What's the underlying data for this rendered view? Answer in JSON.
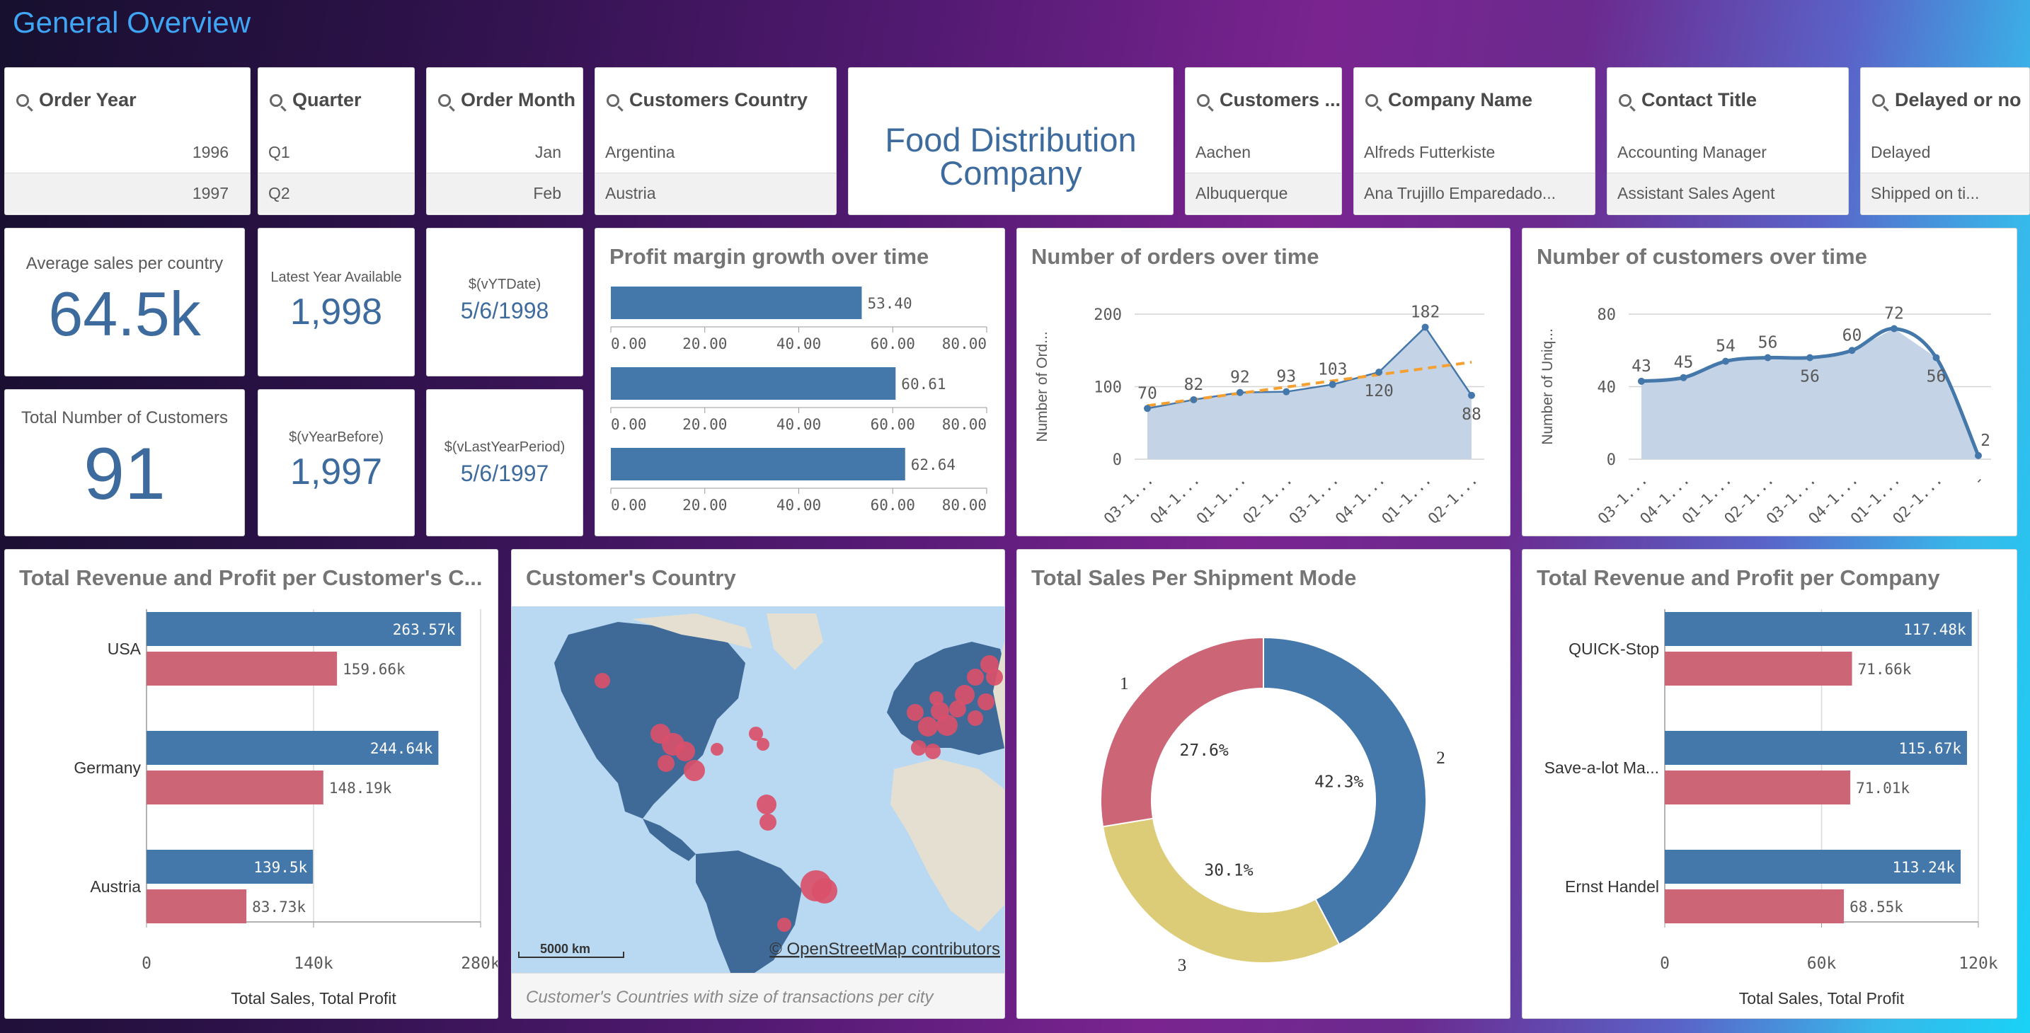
{
  "header": {
    "title": "General Overview"
  },
  "filters": [
    {
      "id": "order-year",
      "title": "Order Year",
      "items": [
        "1996",
        "1997"
      ],
      "numeric": true
    },
    {
      "id": "quarter",
      "title": "Quarter",
      "items": [
        "Q1",
        "Q2"
      ],
      "numeric": false
    },
    {
      "id": "order-month",
      "title": "Order Month",
      "items": [
        "Jan",
        "Feb"
      ],
      "numeric": true
    },
    {
      "id": "customers-country",
      "title": "Customers Country",
      "items": [
        "Argentina",
        "Austria"
      ],
      "numeric": false
    },
    {
      "id": "customers-city",
      "title": "Customers ...",
      "items": [
        "Aachen",
        "Albuquerque"
      ],
      "numeric": false
    },
    {
      "id": "company-name",
      "title": "Company Name",
      "items": [
        "Alfreds Futterkiste",
        "Ana Trujillo Emparedado..."
      ],
      "numeric": false
    },
    {
      "id": "contact-title",
      "title": "Contact Title",
      "items": [
        "Accounting Manager",
        "Assistant Sales Agent"
      ],
      "numeric": false
    },
    {
      "id": "delayed",
      "title": "Delayed or no",
      "items": [
        "Delayed",
        "Shipped on ti..."
      ],
      "numeric": false
    }
  ],
  "company_banner": {
    "line1": "Food Distribution",
    "line2": "Company"
  },
  "kpis": {
    "avg_sales": {
      "label": "Average sales per country",
      "value": "64.5k"
    },
    "total_customers": {
      "label": "Total Number of Customers",
      "value": "91"
    },
    "latest_year": {
      "label": "Latest Year Available",
      "value": "1,998"
    },
    "year_before": {
      "label": "$(vYearBefore)",
      "value": "1,997"
    },
    "ytd": {
      "label": "$(vYTDate)",
      "value": "5/6/1998"
    },
    "last_year_period": {
      "label": "$(vLastYearPeriod)",
      "value": "5/6/1997"
    }
  },
  "charts": {
    "profit_margin": {
      "title": "Profit margin growth over time"
    },
    "orders": {
      "title": "Number of orders over time"
    },
    "customers": {
      "title": "Number of customers over time"
    },
    "revenue_country": {
      "title": "Total Revenue and Profit per Customer's C..."
    },
    "map": {
      "title": "Customer's Country",
      "caption": "Customer's Countries with size of transactions per city",
      "attribution": "© OpenStreetMap contributors",
      "scale": "5000 km"
    },
    "shipment": {
      "title": "Total Sales Per Shipment Mode"
    },
    "revenue_company": {
      "title": "Total Revenue and Profit per Company"
    }
  },
  "colors": {
    "blue": "#4477aa",
    "red": "#cc6677",
    "yellow": "#ddcc77",
    "orange": "#f5a030"
  },
  "chart_data": [
    {
      "id": "profit_margin",
      "type": "bar",
      "orientation": "horizontal",
      "values": [
        53.4,
        60.61,
        62.64
      ],
      "labels": [
        "53.40",
        "60.61",
        "62.64"
      ],
      "xticks": [
        "0.00",
        "20.00",
        "40.00",
        "60.00",
        "80.00"
      ],
      "xlim": [
        0,
        80
      ]
    },
    {
      "id": "orders",
      "type": "area",
      "categories": [
        "Q3-1...",
        "Q4-1...",
        "Q1-1...",
        "Q2-1...",
        "Q3-1...",
        "Q4-1...",
        "Q1-1...",
        "Q2-1..."
      ],
      "values": [
        70,
        82,
        92,
        93,
        103,
        120,
        182,
        88
      ],
      "labels": [
        "70",
        "82",
        "92",
        "93",
        "103",
        "120",
        "182",
        "88"
      ],
      "ylabel": "Number of Ord...",
      "yticks": [
        "0",
        "100",
        "200"
      ],
      "ylim": [
        0,
        200
      ],
      "trendline": true
    },
    {
      "id": "customers",
      "type": "area",
      "categories": [
        "Q3-1...",
        "Q4-1...",
        "Q1-1...",
        "Q2-1...",
        "Q3-1...",
        "Q4-1...",
        "Q1-1...",
        "Q2-1...",
        "-"
      ],
      "values": [
        43,
        45,
        54,
        56,
        56,
        60,
        72,
        56,
        2
      ],
      "labels": [
        "43",
        "45",
        "54",
        "56",
        "56",
        "60",
        "72",
        "56",
        "2"
      ],
      "ylabel": "Number of Uniq...",
      "yticks": [
        "0",
        "40",
        "80"
      ],
      "ylim": [
        0,
        80
      ]
    },
    {
      "id": "revenue_country",
      "type": "bar",
      "orientation": "horizontal",
      "categories": [
        "USA",
        "Germany",
        "Austria"
      ],
      "series": [
        {
          "values": [
            263570,
            244640,
            139500
          ],
          "labels": [
            "263.57k",
            "244.64k",
            "139.5k"
          ]
        },
        {
          "values": [
            159660,
            148190,
            83730
          ],
          "labels": [
            "159.66k",
            "148.19k",
            "83.73k"
          ]
        }
      ],
      "xticks": [
        "0",
        "140k",
        "280k"
      ],
      "xlim": [
        0,
        280000
      ],
      "xlabel": "Total Sales, Total Profit"
    },
    {
      "id": "shipment",
      "type": "pie",
      "slices": [
        {
          "name": "1",
          "value": 27.6,
          "label": "27.6%"
        },
        {
          "name": "2",
          "value": 42.3,
          "label": "42.3%"
        },
        {
          "name": "3",
          "value": 30.1,
          "label": "30.1%"
        }
      ]
    },
    {
      "id": "revenue_company",
      "type": "bar",
      "orientation": "horizontal",
      "categories": [
        "QUICK-Stop",
        "Save-a-lot Ma...",
        "Ernst Handel"
      ],
      "series": [
        {
          "values": [
            117480,
            115670,
            113240
          ],
          "labels": [
            "117.48k",
            "115.67k",
            "113.24k"
          ]
        },
        {
          "values": [
            71660,
            71010,
            68550
          ],
          "labels": [
            "71.66k",
            "71.01k",
            "68.55k"
          ]
        }
      ],
      "xticks": [
        "0",
        "60k",
        "120k"
      ],
      "xlim": [
        0,
        120000
      ],
      "xlabel": "Total Sales, Total Profit"
    }
  ]
}
